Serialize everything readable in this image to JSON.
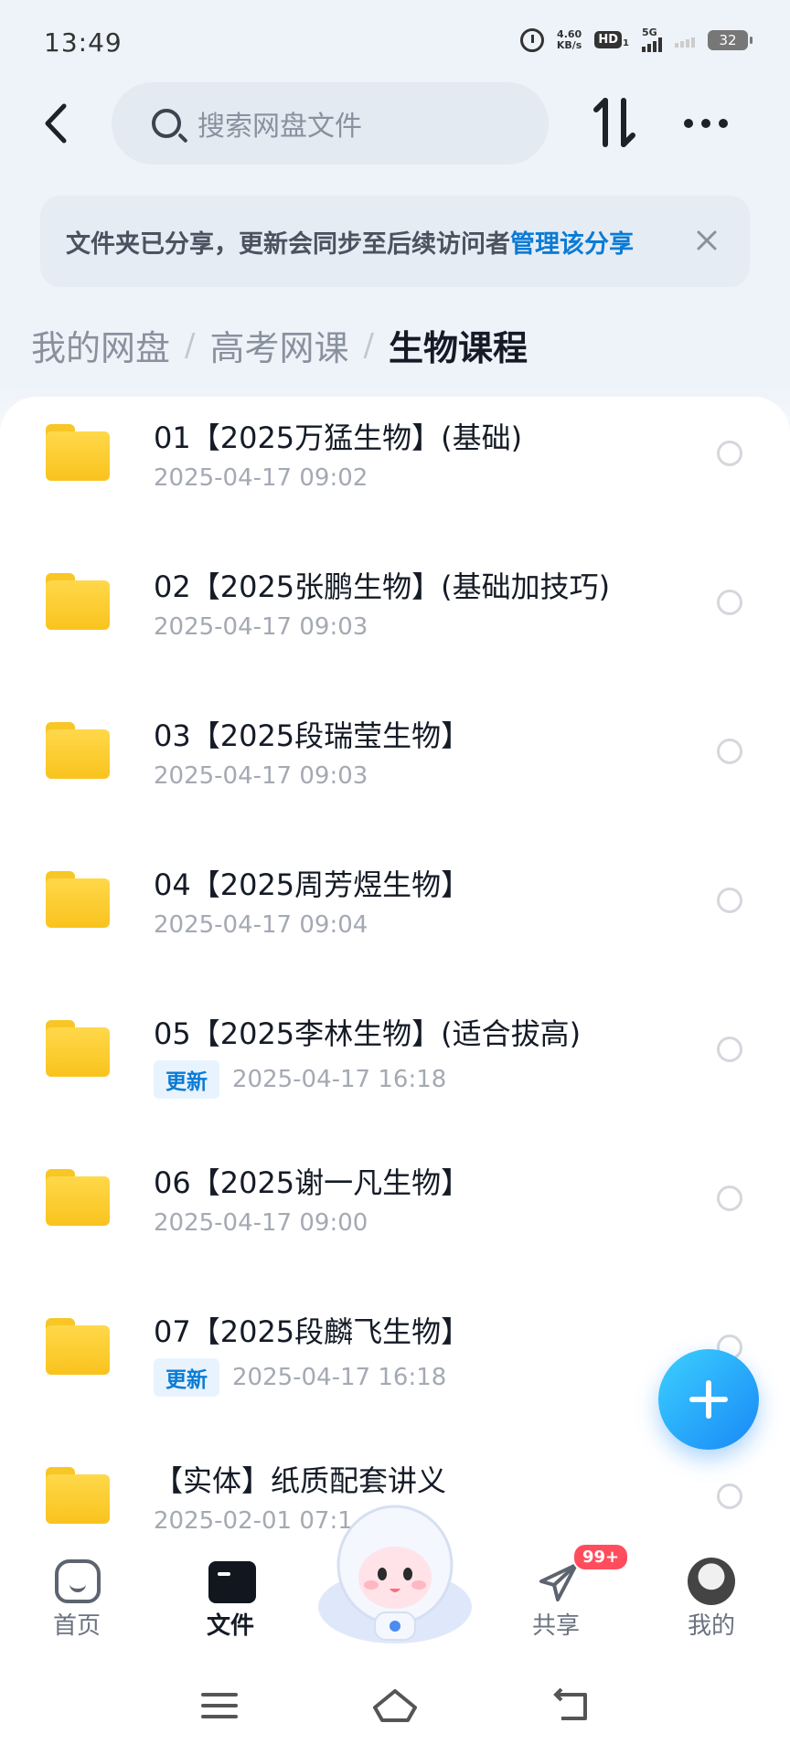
{
  "status_bar": {
    "time": "13:49",
    "net_speed_value": "4.60",
    "net_speed_unit": "KB/s",
    "hd_label": "HD",
    "hd_sub": "1",
    "network_type": "5G",
    "battery": "32"
  },
  "header": {
    "search_placeholder": "搜索网盘文件"
  },
  "notice": {
    "text": "文件夹已分享，更新会同步至后续访问者",
    "link": "管理该分享"
  },
  "breadcrumb": {
    "items": [
      "我的网盘",
      "高考网课"
    ],
    "separator": "/",
    "current": "生物课程"
  },
  "files": [
    {
      "name": "01【2025万猛生物】(基础)",
      "date": "2025-04-17  09:02",
      "badge": ""
    },
    {
      "name": "02【2025张鹏生物】(基础加技巧)",
      "date": "2025-04-17  09:03",
      "badge": ""
    },
    {
      "name": "03【2025段瑞莹生物】",
      "date": "2025-04-17  09:03",
      "badge": ""
    },
    {
      "name": "04【2025周芳煜生物】",
      "date": "2025-04-17  09:04",
      "badge": ""
    },
    {
      "name": "05【2025李林生物】(适合拔高)",
      "date": "2025-04-17  16:18",
      "badge": "更新"
    },
    {
      "name": "06【2025谢一凡生物】",
      "date": "2025-04-17  09:00",
      "badge": ""
    },
    {
      "name": "07【2025段麟飞生物】",
      "date": "2025-04-17  16:18",
      "badge": "更新"
    },
    {
      "name": "【实体】纸质配套讲义",
      "date": "2025-02-01  07:1",
      "badge": ""
    }
  ],
  "tabbar": {
    "home": "首页",
    "files": "文件",
    "share": "共享",
    "share_badge": "99+",
    "mine": "我的"
  },
  "colors": {
    "accent": "#0a7bd6",
    "folder": "#f9c31d",
    "fab": "#1888f6",
    "badge": "#ff4d5e"
  }
}
